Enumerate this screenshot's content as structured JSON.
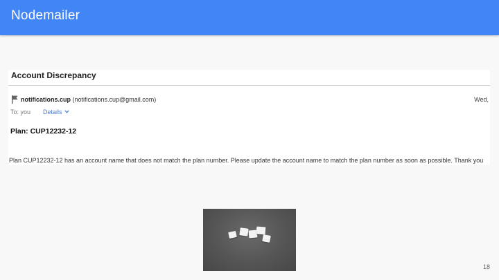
{
  "slide": {
    "title": "Nodemailer",
    "page_number": "18"
  },
  "email": {
    "subject": "Account Discrepancy",
    "sender_name": "notifications.cup",
    "sender_email": "(notifications.cup@gmail.com)",
    "date": "Wed,",
    "to": "To: you",
    "details_label": "Details",
    "heading": "Plan: CUP12232-12",
    "body": "Plan CUP12232-12 has an account name that does not match the plan number. Please update the account name to match the plan number as soon as possible. Thank you"
  },
  "colors": {
    "title_bar": "#4285f4",
    "link": "#4a7bd0"
  },
  "icons": {
    "flag": "flag-icon",
    "chevron": "chevron-down-icon"
  }
}
